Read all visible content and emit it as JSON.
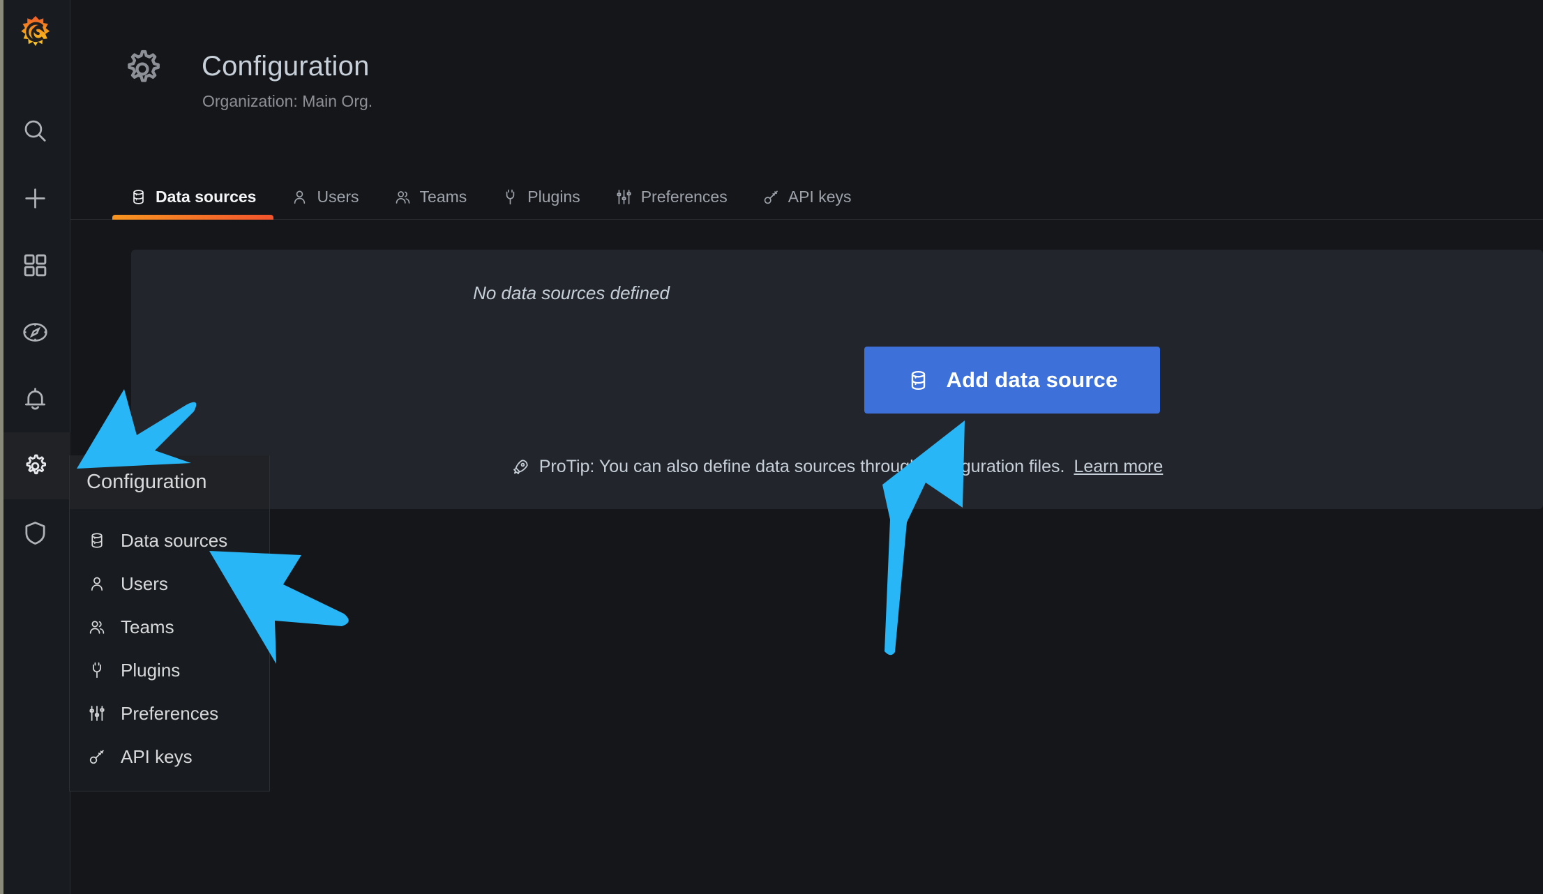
{
  "app": {
    "brand": "grafana-logo",
    "accent_orange": "#e8693a",
    "accent_blue": "#3d71d9",
    "annotation_blue": "#29b6f6",
    "page_bg": "#141619",
    "panel_bg": "#22252b",
    "sidebar_bg": "#181b1f"
  },
  "sidebar": {
    "logo_name": "grafana-logo",
    "items": [
      {
        "name": "search",
        "icon": "search-icon",
        "active": false
      },
      {
        "name": "create",
        "icon": "plus-icon",
        "active": false
      },
      {
        "name": "dashboards",
        "icon": "dashboards-icon",
        "active": false
      },
      {
        "name": "explore",
        "icon": "compass-icon",
        "active": false
      },
      {
        "name": "alerting",
        "icon": "bell-icon",
        "active": false
      },
      {
        "name": "configuration",
        "icon": "gear-icon",
        "active": true
      },
      {
        "name": "server-admin",
        "icon": "shield-icon",
        "active": false
      }
    ]
  },
  "header": {
    "icon": "gear-icon",
    "title": "Configuration",
    "subtitle": "Organization: Main Org."
  },
  "tabs": [
    {
      "label": "Data sources",
      "icon": "database-icon",
      "active": true
    },
    {
      "label": "Users",
      "icon": "user-icon",
      "active": false
    },
    {
      "label": "Teams",
      "icon": "users-icon",
      "active": false
    },
    {
      "label": "Plugins",
      "icon": "plug-icon",
      "active": false
    },
    {
      "label": "Preferences",
      "icon": "sliders-icon",
      "active": false
    },
    {
      "label": "API keys",
      "icon": "key-icon",
      "active": false
    }
  ],
  "main": {
    "empty_message": "No data sources defined",
    "add_button": {
      "label": "Add data source",
      "icon": "database-icon"
    },
    "protip": {
      "icon": "rocket-icon",
      "text": "ProTip: You can also define data sources through configuration files.",
      "link_label": "Learn more"
    }
  },
  "dropdown": {
    "title": "Configuration",
    "items": [
      {
        "label": "Data sources",
        "icon": "database-icon"
      },
      {
        "label": "Users",
        "icon": "user-icon"
      },
      {
        "label": "Teams",
        "icon": "users-icon"
      },
      {
        "label": "Plugins",
        "icon": "plug-icon"
      },
      {
        "label": "Preferences",
        "icon": "sliders-icon"
      },
      {
        "label": "API keys",
        "icon": "key-icon"
      }
    ]
  },
  "annotations": [
    {
      "name": "arrow-to-configuration-nav-icon",
      "points_to": "configuration sidebar gear icon"
    },
    {
      "name": "arrow-to-data-sources-menu-item",
      "points_to": "Data sources menu item"
    },
    {
      "name": "arrow-to-add-data-source-button",
      "points_to": "Add data source button"
    }
  ]
}
